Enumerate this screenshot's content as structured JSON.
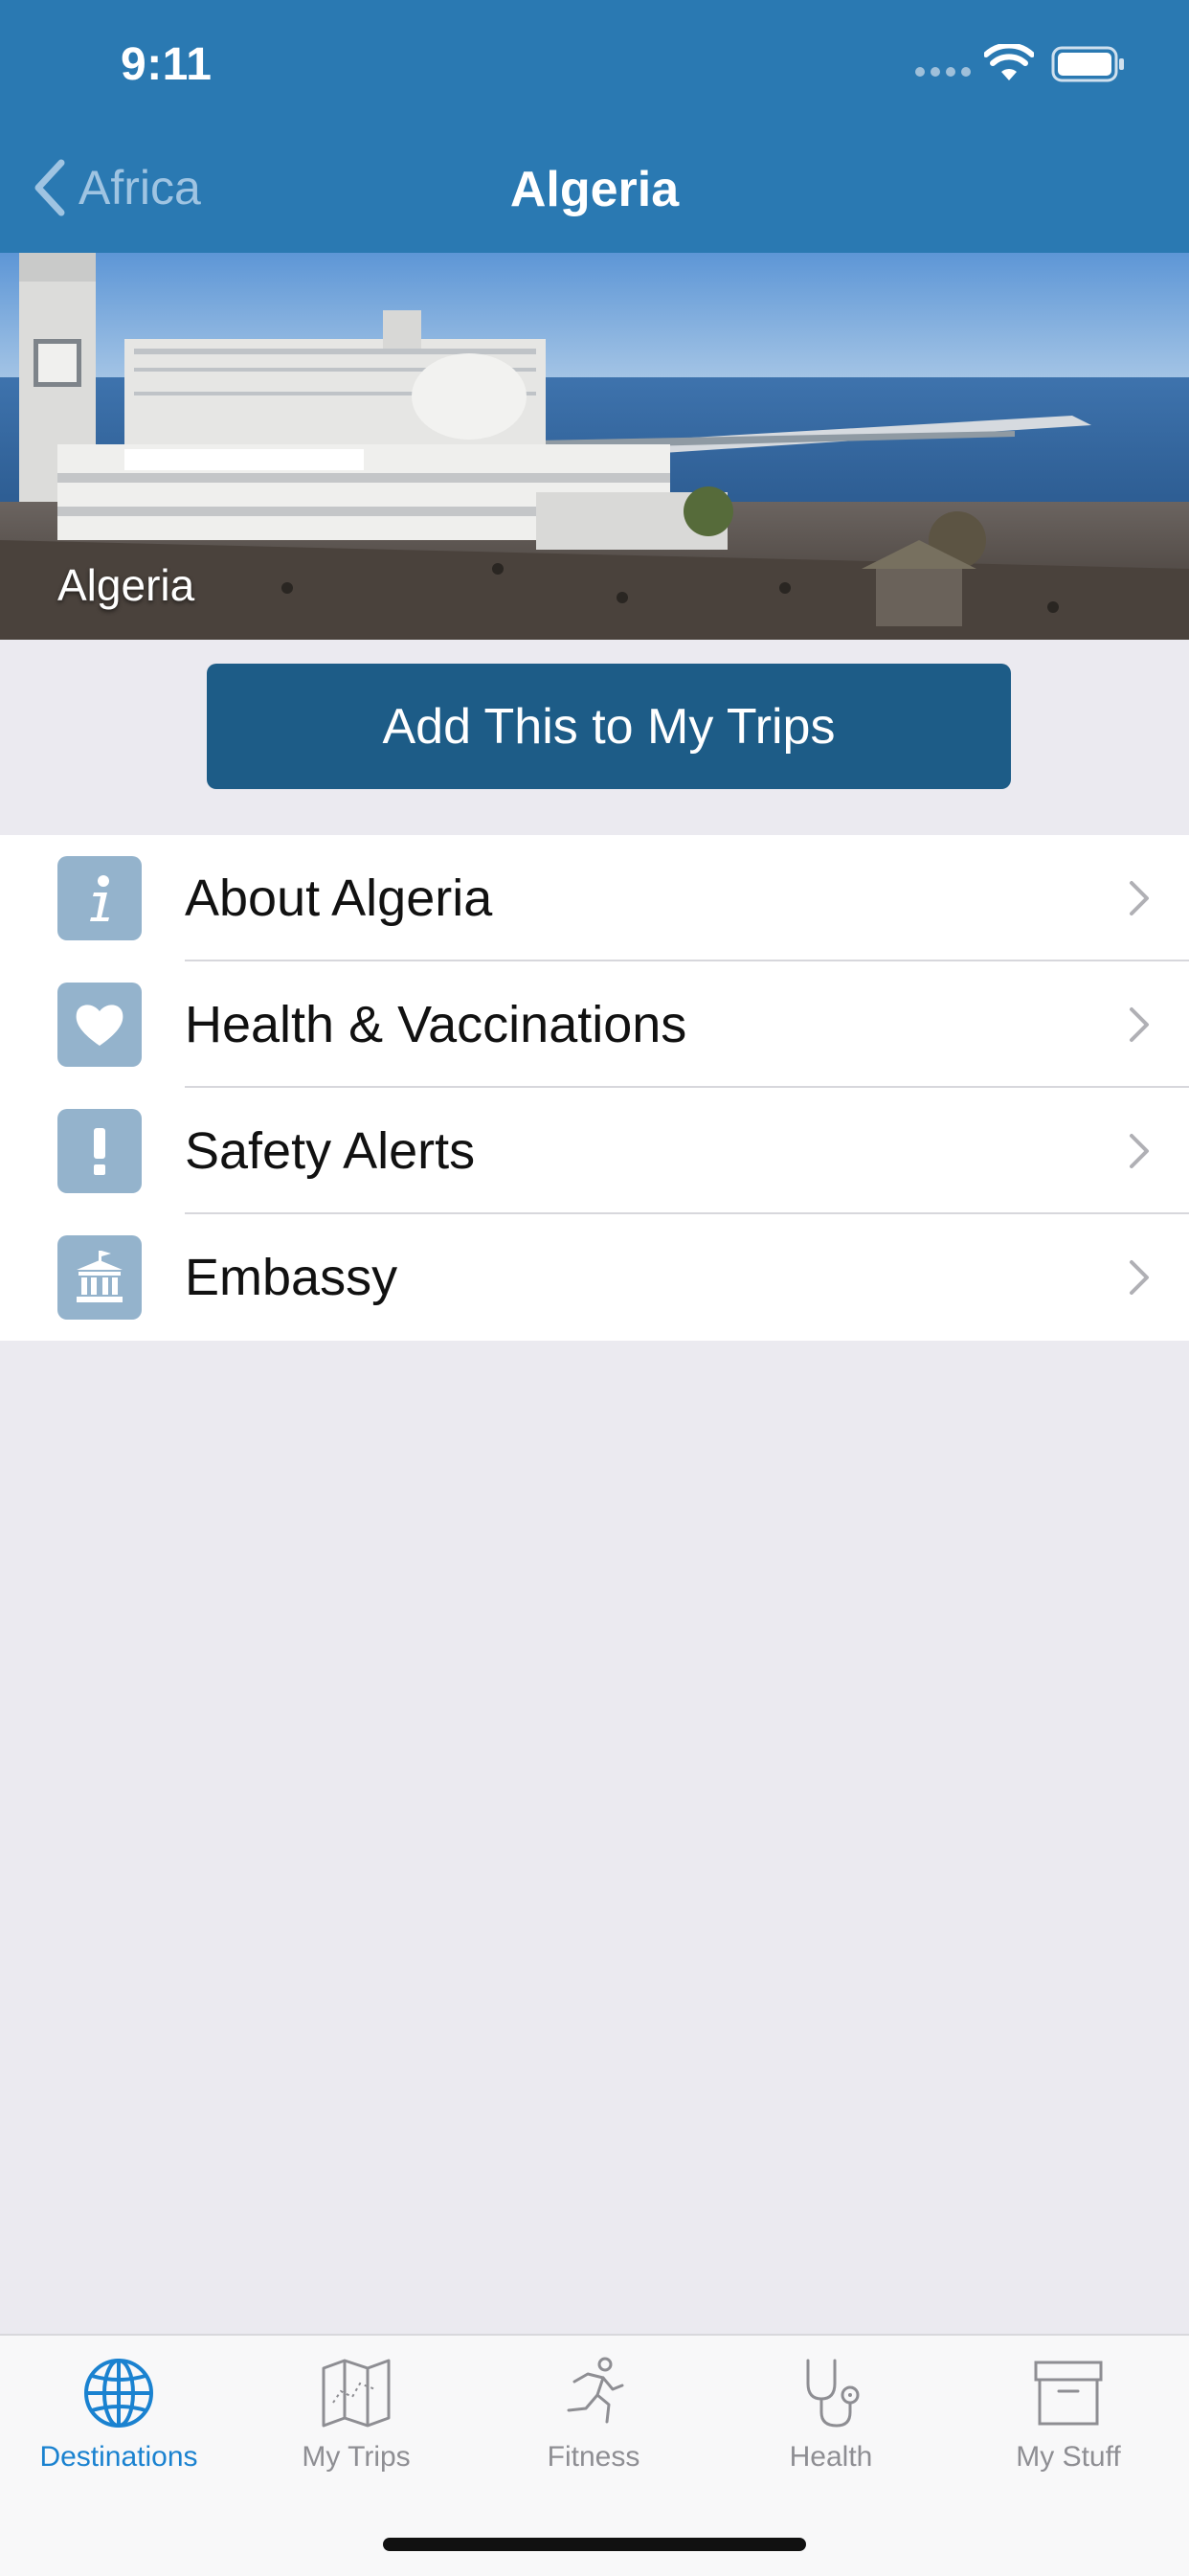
{
  "status": {
    "time": "9:11"
  },
  "nav": {
    "back_label": "Africa",
    "title": "Algeria"
  },
  "hero": {
    "caption": "Algeria"
  },
  "actions": {
    "add_trip_label": "Add This to My Trips"
  },
  "menu": [
    {
      "label": "About Algeria",
      "icon": "info-icon"
    },
    {
      "label": "Health & Vaccinations",
      "icon": "heart-icon"
    },
    {
      "label": "Safety Alerts",
      "icon": "exclamation-icon"
    },
    {
      "label": "Embassy",
      "icon": "embassy-building-icon"
    }
  ],
  "tabs": [
    {
      "label": "Destinations",
      "icon": "globe-icon",
      "active": true
    },
    {
      "label": "My Trips",
      "icon": "map-icon",
      "active": false
    },
    {
      "label": "Fitness",
      "icon": "runner-icon",
      "active": false
    },
    {
      "label": "Health",
      "icon": "stethoscope-icon",
      "active": false
    },
    {
      "label": "My Stuff",
      "icon": "archive-box-icon",
      "active": false
    }
  ],
  "colors": {
    "nav_bar": "#2a79b2",
    "button": "#1d5c87",
    "active_tab": "#1a82d0",
    "icon_tile": "#94b3cc",
    "background": "#ebeaf0"
  }
}
